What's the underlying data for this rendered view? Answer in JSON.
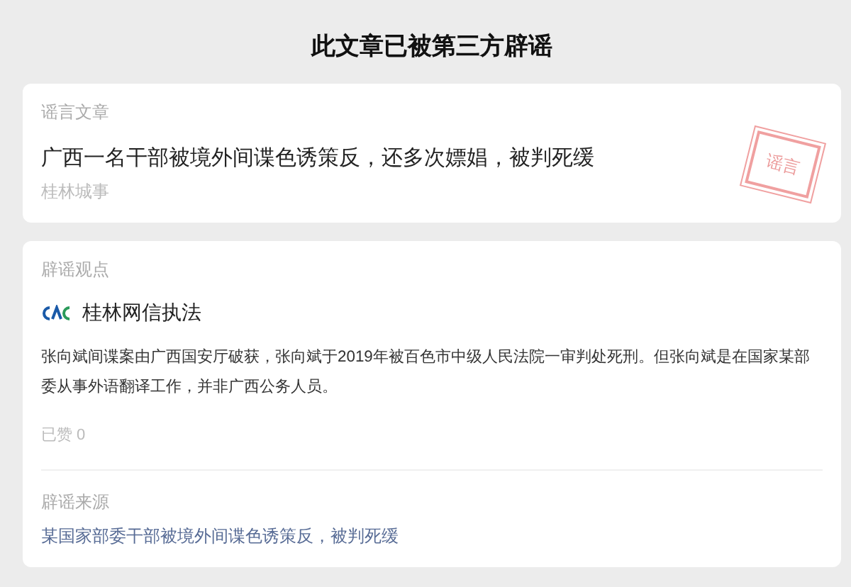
{
  "title": "此文章已被第三方辟谣",
  "rumor": {
    "label": "谣言文章",
    "headline": "广西一名干部被境外间谍色诱策反，还多次嫖娼，被判死缓",
    "source": "桂林城事",
    "stamp": "谣言"
  },
  "debunk": {
    "label": "辟谣观点",
    "publisher": "桂林网信执法",
    "body": "张向斌间谍案由广西国安厅破获，张向斌于2019年被百色市中级人民法院一审判处死刑。但张向斌是在国家某部委从事外语翻译工作，并非广西公务人员。",
    "likes": "已赞 0",
    "source_label": "辟谣来源",
    "source_link": "某国家部委干部被境外间谍色诱策反，被判死缓"
  }
}
